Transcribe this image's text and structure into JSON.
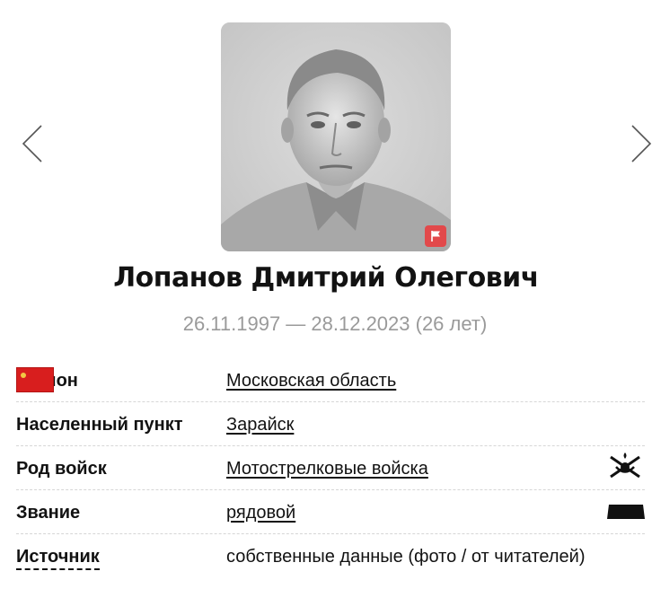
{
  "profile": {
    "name": "Лопанов Дмитрий Олегович",
    "dates": "26.11.1997 — 28.12.2023 (26 лет)"
  },
  "navigation": {
    "prev_icon": "chevron-left-icon",
    "next_icon": "chevron-right-icon"
  },
  "details": {
    "region": {
      "label": "Регион",
      "value": "Московская область",
      "icon": "region-flag-icon"
    },
    "settlement": {
      "label": "Населенный пункт",
      "value": "Зарайск"
    },
    "branch": {
      "label": "Род войск",
      "value": "Мотострелковые войска",
      "icon": "motor-rifle-emblem-icon"
    },
    "rank": {
      "label": "Звание",
      "value": "рядовой",
      "icon": "rank-insignia-icon"
    },
    "source": {
      "label": "Источник",
      "value": "собственные данные (фото / от читателей)"
    }
  },
  "colors": {
    "badge": "#e2494b",
    "region_flag": "#d81e1e",
    "dates_text": "#9a9a9a"
  }
}
